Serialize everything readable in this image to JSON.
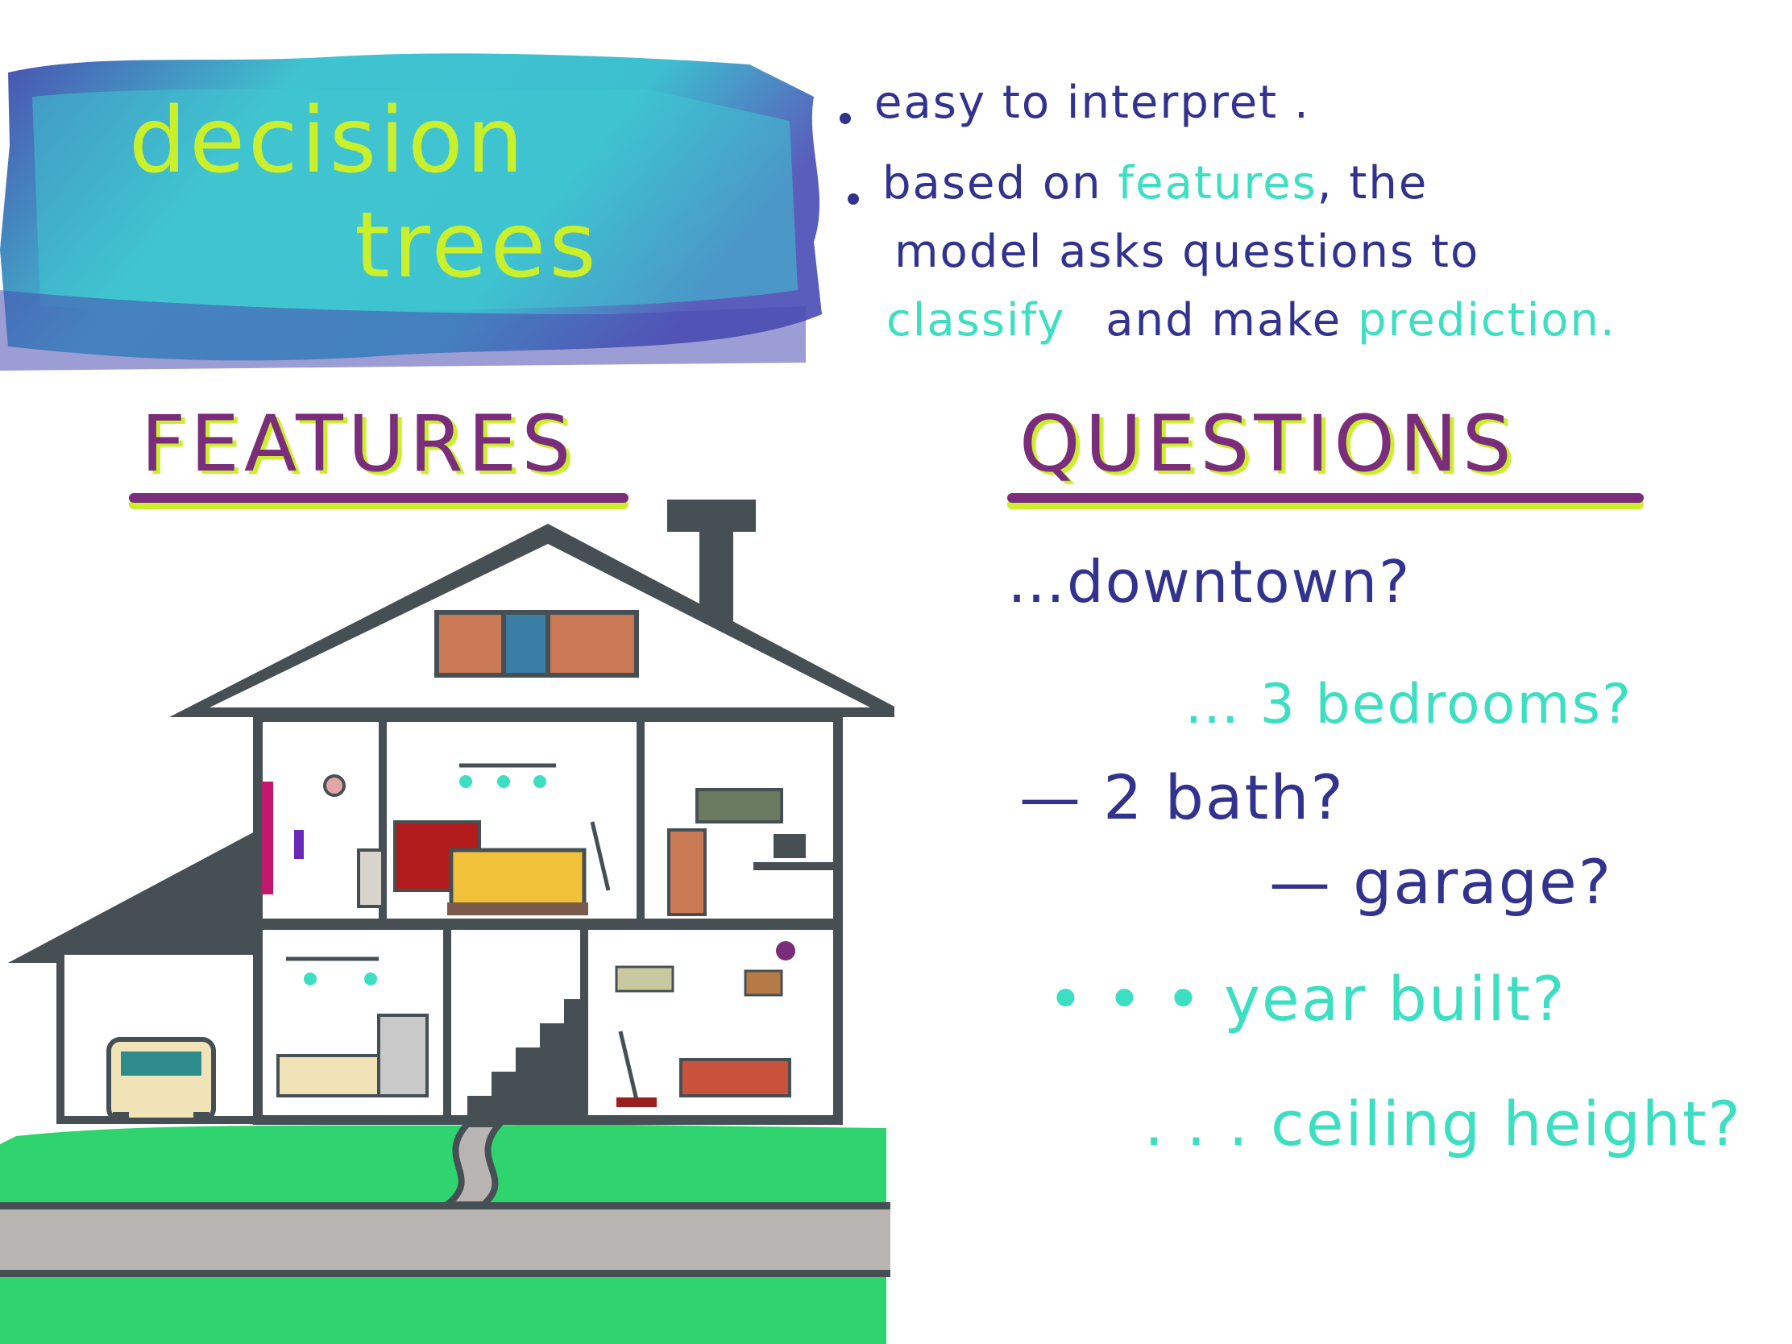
{
  "title": {
    "line1": "decision",
    "line2": "trees"
  },
  "bullets": {
    "b1": "easy to interpret .",
    "b2_prefix": "based on",
    "b2_feature": "features",
    "b2_suffix": ", the",
    "b2_line2": "model  asks questions  to",
    "b2_classify": "classify",
    "b2_mid": "and make",
    "b2_prediction": "prediction."
  },
  "headings": {
    "features": "FEATURES",
    "questions": "QUESTIONS"
  },
  "questions": [
    {
      "text": "…downtown?",
      "color": "#32328f"
    },
    {
      "text": "… 3 bedrooms?",
      "color": "#3ddfc2"
    },
    {
      "text": "— 2 bath?",
      "color": "#32328f"
    },
    {
      "text": "— garage?",
      "color": "#32328f"
    },
    {
      "text": "• • • year built?",
      "color": "#3ddfc2"
    },
    {
      "text": ". . . ceiling height?",
      "color": "#3ddfc2"
    }
  ],
  "colors": {
    "navy": "#32328f",
    "teal": "#3ddfc2",
    "lime": "#c9f02a",
    "purple": "#7a2d7a",
    "grass": "#2fd46e",
    "road": "#b9b5b2",
    "house_outline": "#465054"
  },
  "illustration": "house-cutaway-icon"
}
